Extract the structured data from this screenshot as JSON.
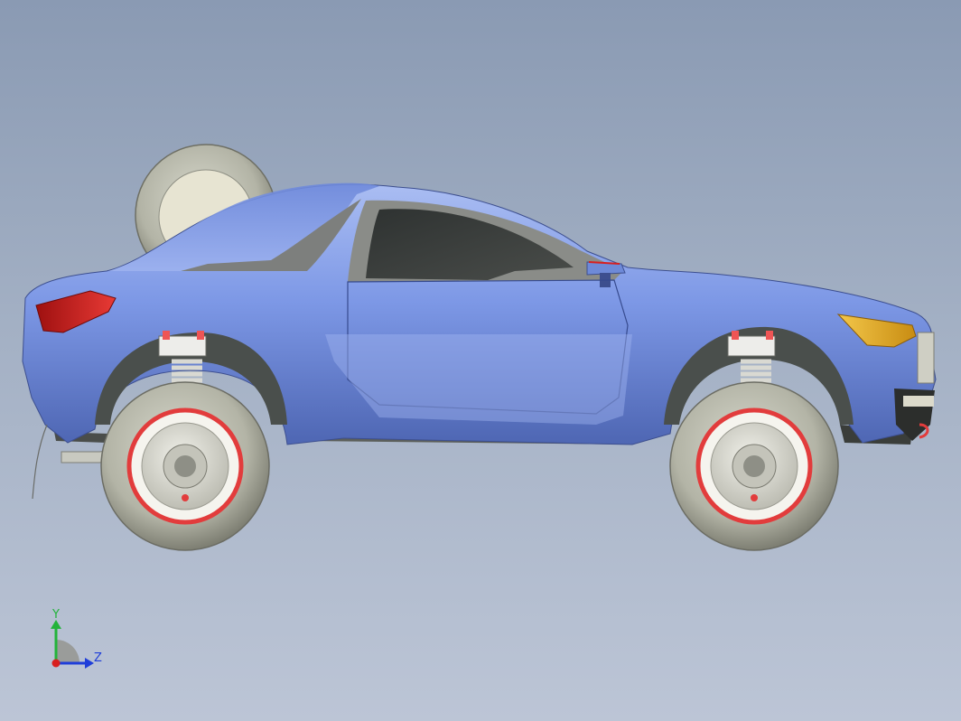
{
  "viewport": {
    "background_top": "#8a9ab3",
    "background_bottom": "#bcc5d6"
  },
  "model": {
    "body_color": "#7d98e6",
    "body_highlight": "#aabdf2",
    "body_shadow": "#4e66b3",
    "tail_light_color": "#d8201f",
    "headlight_color": "#e8b221",
    "rim_color": "#e23c3c",
    "tire_color": "#bfc0b3",
    "hub_color": "#d8d9d0"
  },
  "triad": {
    "y_label": "Y",
    "z_label": "Z",
    "y_color": "#22b33a",
    "z_color": "#1f3ed9",
    "x_color": "#d81f1f"
  }
}
